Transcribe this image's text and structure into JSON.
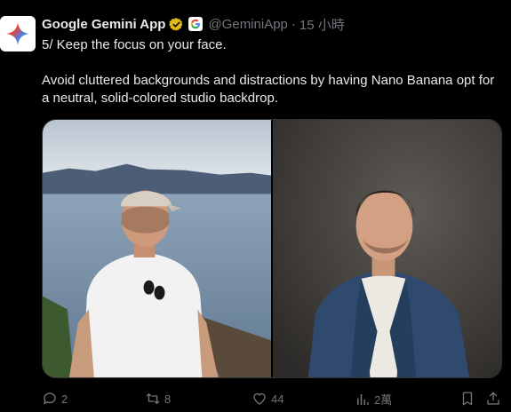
{
  "post": {
    "author": {
      "display_name": "Google Gemini App",
      "handle": "@GeminiApp",
      "separator": "·",
      "timestamp": "15 小時",
      "verified_color": "#e2b719",
      "avatar_icon": "gemini-sparkle-icon",
      "affiliate_icon": "google-g-icon"
    },
    "paragraphs": [
      "5/ Keep the focus on your face.",
      "Avoid cluttered backgrounds and distractions by having Nano Banana opt for a neutral, solid-colored studio backdrop."
    ],
    "media": [
      {
        "description_icon": "photo-outdoor-lake"
      },
      {
        "description_icon": "photo-studio-portrait"
      }
    ],
    "actions": {
      "replies": "2",
      "reposts": "8",
      "likes": "44",
      "views": "2萬"
    }
  },
  "colors": {
    "background": "#000000",
    "text_primary": "#e7e9ea",
    "text_secondary": "#71767b",
    "border": "#2f3336"
  }
}
